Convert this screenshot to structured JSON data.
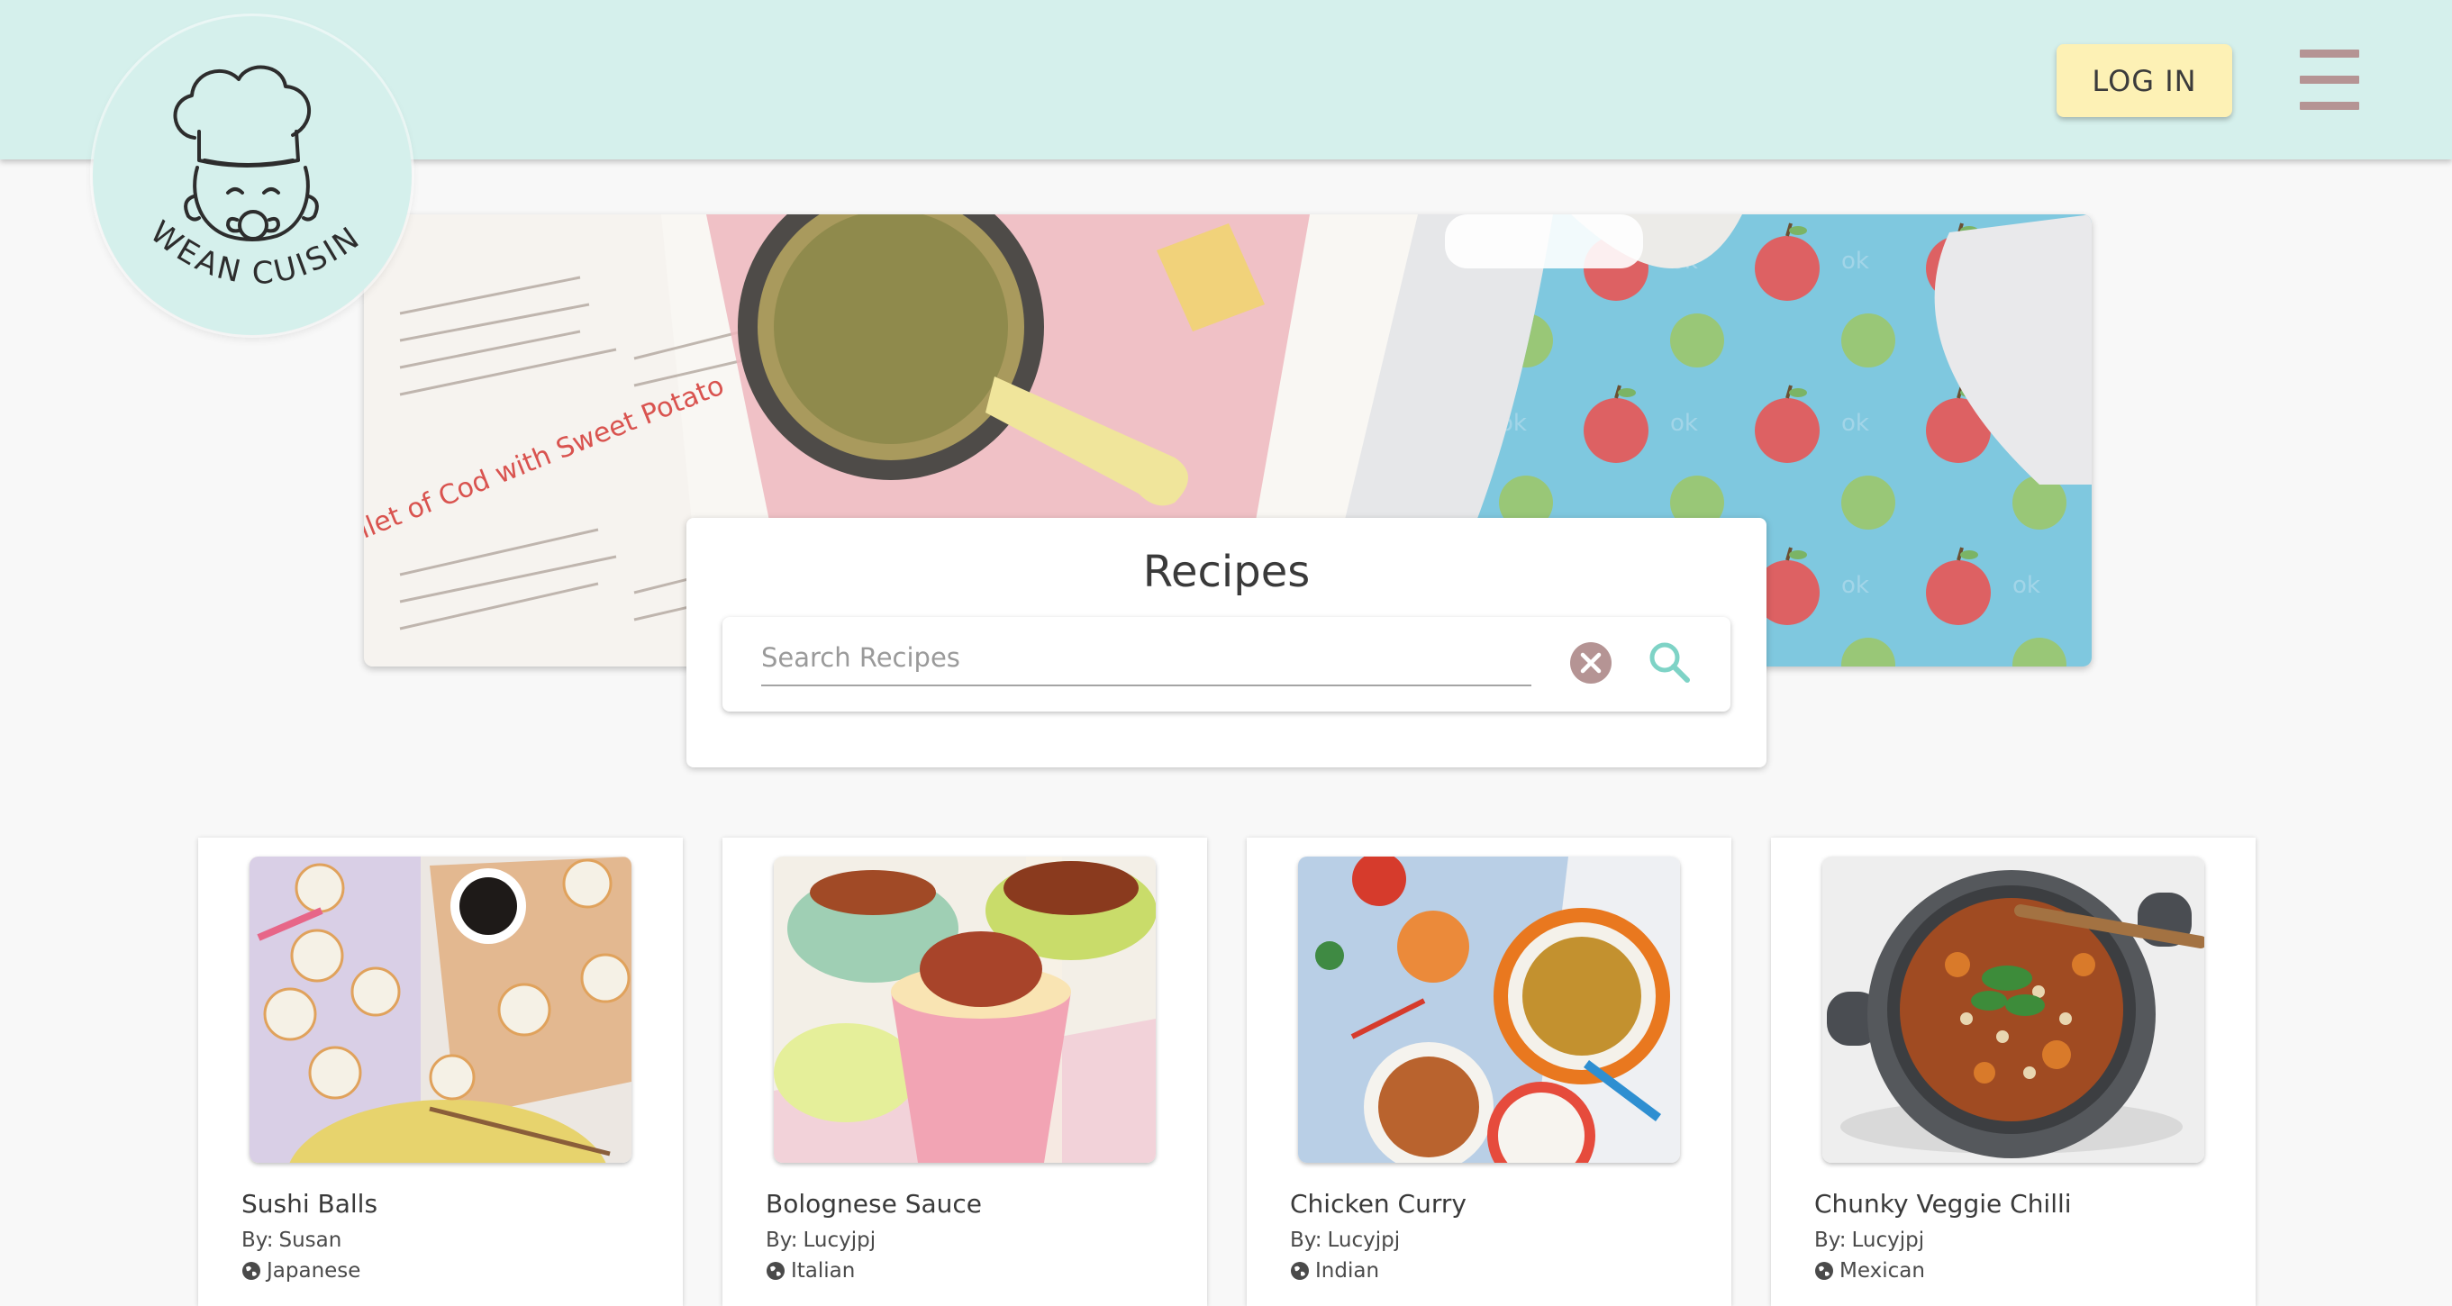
{
  "brand": {
    "logo_text": "WEAN CUISINE",
    "accent": "#d5f0ec",
    "login_color": "#fdf1b5",
    "menu_color": "#b59494"
  },
  "header": {
    "login_label": "LOG IN",
    "menu_icon": "hamburger-menu-icon"
  },
  "search": {
    "title": "Recipes",
    "placeholder": "Search Recipes",
    "value": "",
    "clear_icon": "close-circle-icon",
    "search_icon": "magnifier-icon"
  },
  "recipes": [
    {
      "title": "Sushi Balls",
      "by_label": "By:",
      "author": "Susan",
      "cuisine": "Japanese"
    },
    {
      "title": "Bolognese Sauce",
      "by_label": "By:",
      "author": "Lucyjpj",
      "cuisine": "Italian"
    },
    {
      "title": "Chicken Curry",
      "by_label": "By:",
      "author": "Lucyjpj",
      "cuisine": "Indian"
    },
    {
      "title": "Chunky Veggie Chilli",
      "by_label": "By:",
      "author": "Lucyjpj",
      "cuisine": "Mexican"
    }
  ]
}
